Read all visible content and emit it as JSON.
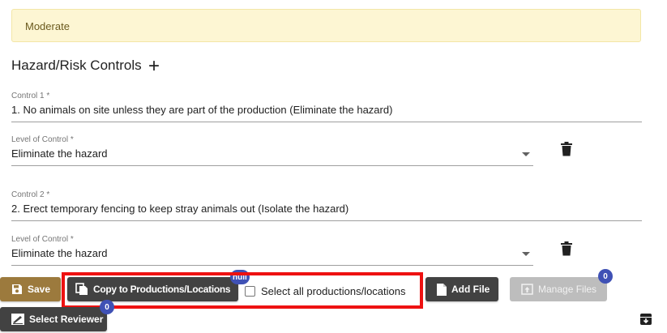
{
  "risk_banner": {
    "text": "Moderate"
  },
  "section": {
    "title": "Hazard/Risk Controls",
    "add_label": "+"
  },
  "controls": [
    {
      "control_label": "Control 1 *",
      "control_value": "1. No animals on site unless they are part of the production (Eliminate the hazard)",
      "level_label": "Level of Control *",
      "level_value": "Eliminate the hazard"
    },
    {
      "control_label": "Control 2 *",
      "control_value": "2. Erect temporary fencing to keep stray animals out (Isolate the hazard)",
      "level_label": "Level of Control *",
      "level_value": "Eliminate the hazard"
    }
  ],
  "actions": {
    "save_label": "Save",
    "copy_label": "Copy to Productions/Locations",
    "copy_badge": "null",
    "select_all_label": "Select all productions/locations",
    "add_file_label": "Add File",
    "manage_files_label": "Manage Files",
    "manage_files_badge": "0",
    "select_reviewer_label": "Select Reviewer",
    "select_reviewer_badge": "0"
  },
  "icons": {
    "delete": "trash-icon",
    "save": "floppy-disk-icon",
    "copy": "copy-icon",
    "add_file": "file-icon",
    "manage_files": "upload-file-icon",
    "reviewer": "signature-icon",
    "archive": "archive-icon"
  },
  "colors": {
    "banner_bg": "#fdf6d3",
    "save": "#9c7a3d",
    "dark_button": "#424242",
    "disabled_button": "#bdbdbd",
    "badge": "#3f51b5",
    "highlight": "#ee1111"
  }
}
